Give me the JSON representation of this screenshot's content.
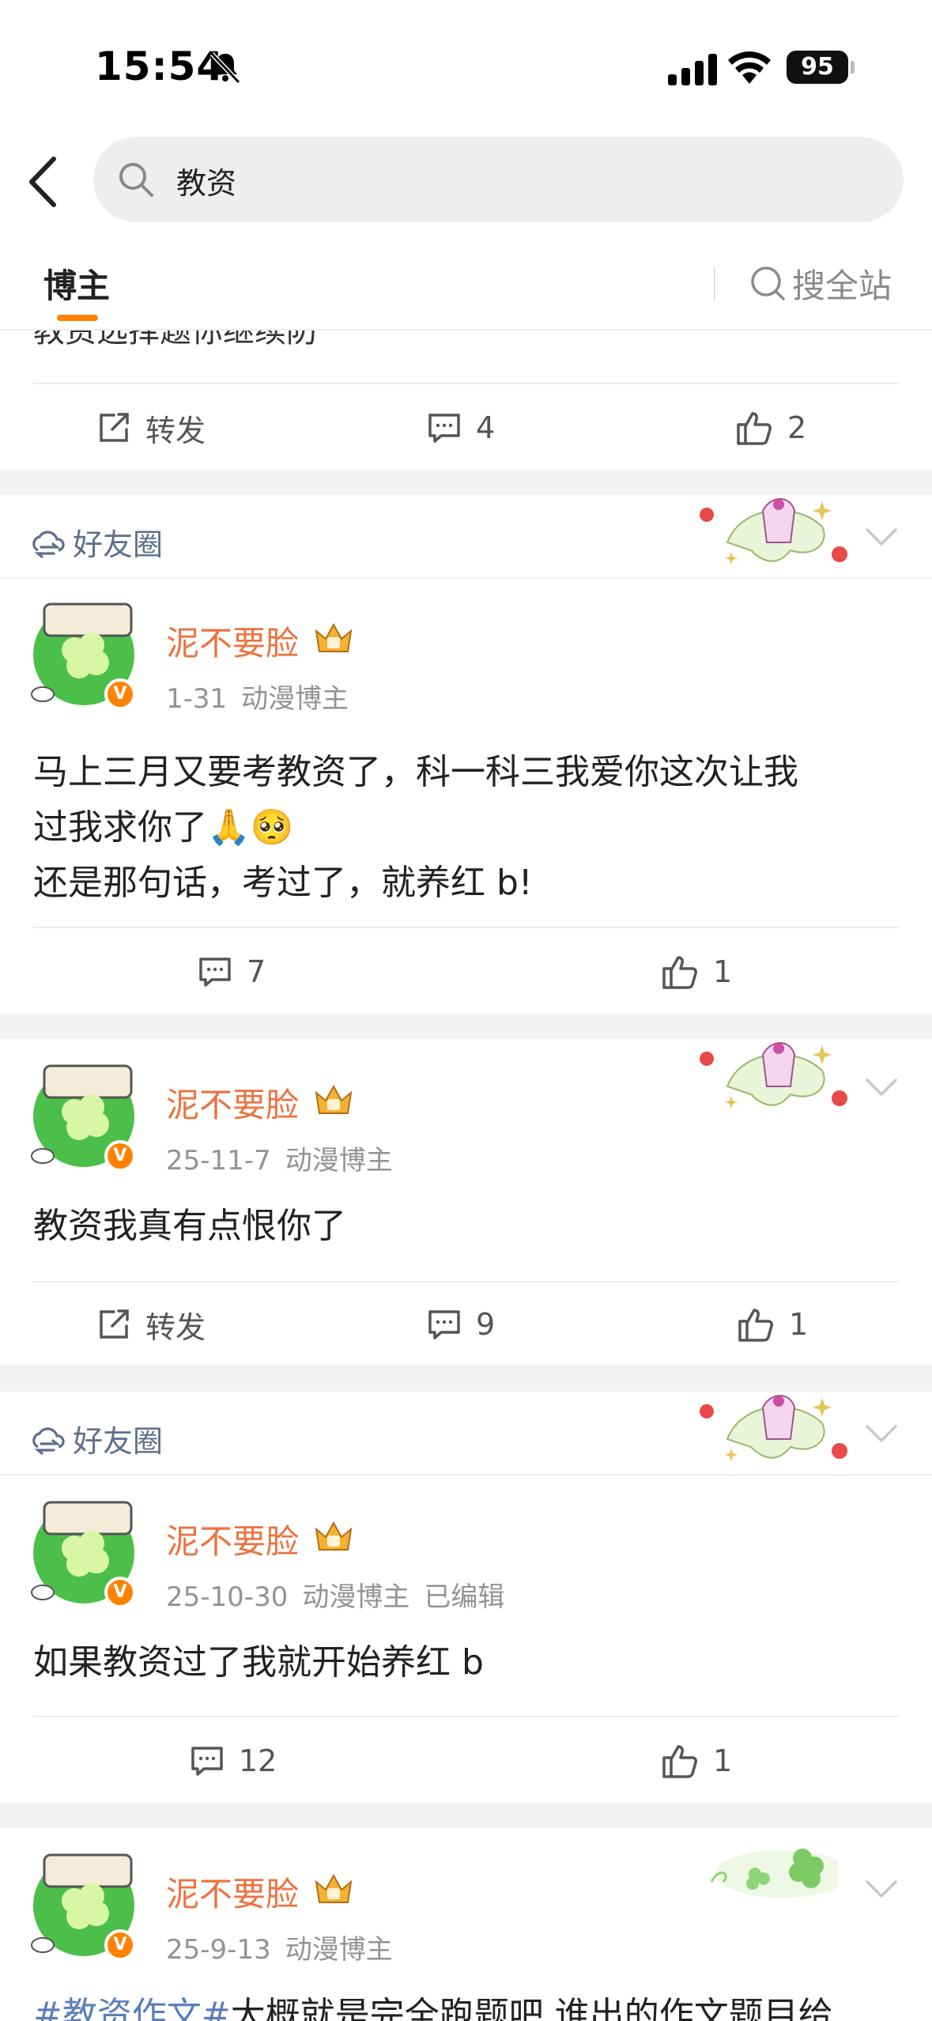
{
  "status": {
    "time": "15:54",
    "battery": "95"
  },
  "search": {
    "query": "教资"
  },
  "tabs": {
    "active": "博主",
    "search_all": "搜全站"
  },
  "post0": {
    "cut_text": "教资选择题你继续防",
    "repost_label": "转发",
    "comments": "4",
    "likes": "2"
  },
  "posts": [
    {
      "circle_label": "好友圈",
      "author": "泥不要脸",
      "date": "1-31",
      "tag": "动漫博主",
      "lines": [
        "马上三月又要考教资了，科一科三我爱你这次让我",
        "过我求你了🙏🥺",
        "还是那句话，考过了，就养红 b!"
      ],
      "comments": "7",
      "likes": "1"
    },
    {
      "author": "泥不要脸",
      "date": "25-11-7",
      "tag": "动漫博主",
      "text": "教资我真有点恨你了",
      "repost_label": "转发",
      "comments": "9",
      "likes": "1"
    },
    {
      "circle_label": "好友圈",
      "author": "泥不要脸",
      "date": "25-10-30",
      "tag": "动漫博主",
      "edited": "已编辑",
      "text": "如果教资过了我就开始养红 b",
      "comments": "12",
      "likes": "1"
    },
    {
      "author": "泥不要脸",
      "date": "25-9-13",
      "tag": "动漫博主",
      "hashtag": "#教资作文#",
      "text": "大概就是完全跑题吧 谁出的作文题目给"
    }
  ],
  "colors": {
    "accent": "#ff8200",
    "username": "#eb7340",
    "meta": "#939393",
    "link": "#5b7fb8",
    "background": "#f2f2f2"
  },
  "icons": [
    "back-icon",
    "search-icon",
    "repost-icon",
    "comment-icon",
    "like-icon",
    "circle-icon",
    "chevron-down-icon",
    "crown-icon",
    "verified-icon"
  ]
}
